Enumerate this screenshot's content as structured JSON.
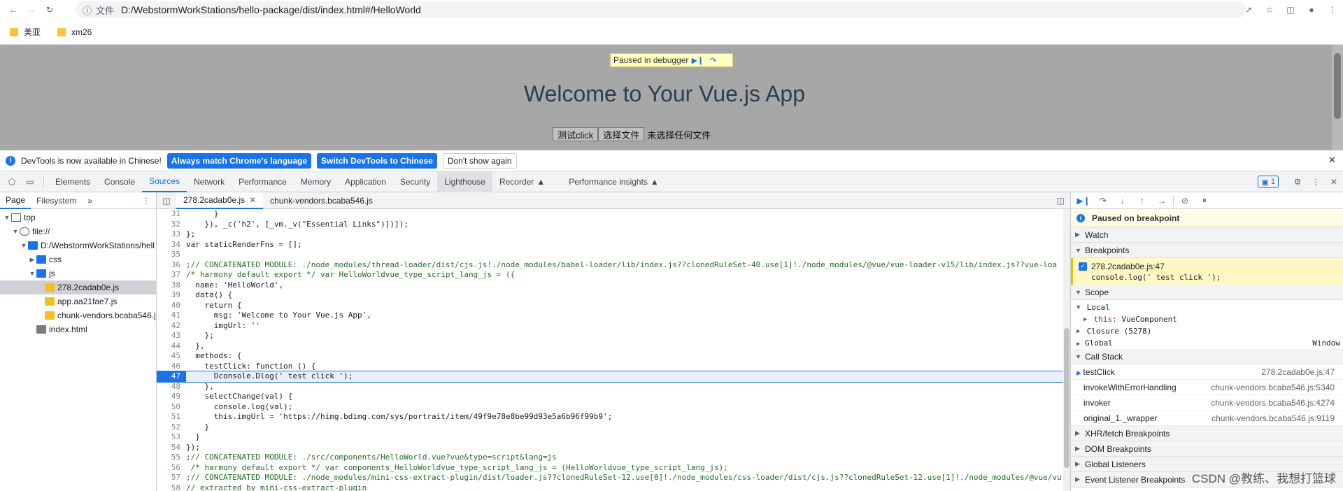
{
  "browser": {
    "file_label": "文件",
    "url": "D:/WebstormWorkStations/hello-package/dist/index.html#/HelloWorld",
    "bookmarks": [
      "美亚",
      "xm26"
    ]
  },
  "page": {
    "paused_text": "Paused in debugger",
    "title": "Welcome to Your Vue.js App",
    "test_button": "测试click",
    "file_button": "选择文件",
    "no_file": "未选择任何文件"
  },
  "infobar": {
    "message": "DevTools is now available in Chinese!",
    "btn_match": "Always match Chrome's language",
    "btn_switch": "Switch DevTools to Chinese",
    "btn_dont": "Don't show again"
  },
  "devtools": {
    "tabs": [
      "Elements",
      "Console",
      "Sources",
      "Network",
      "Performance",
      "Memory",
      "Application",
      "Security",
      "Lighthouse",
      "Recorder",
      "Performance insights"
    ],
    "issues_count": "1"
  },
  "navigator": {
    "tabs": [
      "Page",
      "Filesystem"
    ],
    "tree": [
      {
        "label": "top",
        "depth": 0,
        "icon": "frame",
        "open": true
      },
      {
        "label": "file://",
        "depth": 1,
        "icon": "cloud",
        "open": true
      },
      {
        "label": "D:/WebstormWorkStations/hell",
        "depth": 2,
        "icon": "folder",
        "open": true
      },
      {
        "label": "css",
        "depth": 3,
        "icon": "folder",
        "open": false
      },
      {
        "label": "js",
        "depth": 3,
        "icon": "folder",
        "open": true
      },
      {
        "label": "278.2cadab0e.js",
        "depth": 4,
        "icon": "file",
        "selected": true
      },
      {
        "label": "app.aa21fae7.js",
        "depth": 4,
        "icon": "file"
      },
      {
        "label": "chunk-vendors.bcaba546.j",
        "depth": 4,
        "icon": "file"
      },
      {
        "label": "index.html",
        "depth": 3,
        "icon": "html"
      }
    ]
  },
  "editor": {
    "tabs": [
      "278.2cadab0e.js",
      "chunk-vendors.bcaba546.js"
    ],
    "lines": [
      {
        "n": "31",
        "t": "      }"
      },
      {
        "n": "32",
        "t": "    }), _c('h2', [_vm._v(\"Essential Links\")])]);"
      },
      {
        "n": "33",
        "t": "};"
      },
      {
        "n": "34",
        "t": "var staticRenderFns = [];"
      },
      {
        "n": "35",
        "t": ""
      },
      {
        "n": "36",
        "t": ";// CONCATENATED MODULE: ./node_modules/thread-loader/dist/cjs.js!./node_modules/babel-loader/lib/index.js??clonedRuleSet-40.use[1]!./node_modules/@vue/vue-loader-v15/lib/index.js??vue-loa"
      },
      {
        "n": "37",
        "t": "/* harmony default export */ var HelloWorldvue_type_script_lang_js = ({"
      },
      {
        "n": "38",
        "t": "  name: 'HelloWorld',"
      },
      {
        "n": "39",
        "t": "  data() {"
      },
      {
        "n": "40",
        "t": "    return {"
      },
      {
        "n": "41",
        "t": "      msg: 'Welcome to Your Vue.js App',"
      },
      {
        "n": "42",
        "t": "      imgUrl: ''"
      },
      {
        "n": "43",
        "t": "    };"
      },
      {
        "n": "44",
        "t": "  },"
      },
      {
        "n": "45",
        "t": "  methods: {"
      },
      {
        "n": "46",
        "t": "    testClick: function () {"
      },
      {
        "n": "47",
        "t": "      Dconsole.Dlog(' test click ');",
        "exec": true
      },
      {
        "n": "48",
        "t": "    },"
      },
      {
        "n": "49",
        "t": "    selectChange(val) {"
      },
      {
        "n": "50",
        "t": "      console.log(val);"
      },
      {
        "n": "51",
        "t": "      this.imgUrl = 'https://himg.bdimg.com/sys/portrait/item/49f9e78e8be99d93e5a6b96f99b9';"
      },
      {
        "n": "52",
        "t": "    }"
      },
      {
        "n": "53",
        "t": "  }"
      },
      {
        "n": "54",
        "t": "});"
      },
      {
        "n": "55",
        "t": ";// CONCATENATED MODULE: ./src/components/HelloWorld.vue?vue&type=script&lang=js"
      },
      {
        "n": "56",
        "t": " /* harmony default export */ var components_HelloWorldvue_type_script_lang_js = (HelloWorldvue_type_script_lang_js);"
      },
      {
        "n": "57",
        "t": ";// CONCATENATED MODULE: ./node_modules/mini-css-extract-plugin/dist/loader.js??clonedRuleSet-12.use[0]!./node_modules/css-loader/dist/cjs.js??clonedRuleSet-12.use[1]!./node_modules/@vue/vu"
      },
      {
        "n": "58",
        "t": "// extracted by mini-css-extract-plugin"
      }
    ]
  },
  "debugger": {
    "paused": "Paused on breakpoint",
    "watch": "Watch",
    "breakpoints": "Breakpoints",
    "bp_file": "278.2cadab0e.js:47",
    "bp_code": "console.log(' test click ');",
    "scope": "Scope",
    "local": "Local",
    "this_key": "this:",
    "this_val": "VueComponent",
    "closure": "Closure (5278)",
    "global": "Global",
    "global_val": "Window",
    "callstack": "Call Stack",
    "frames": [
      {
        "name": "testClick",
        "loc": "278.2cadab0e.js:47"
      },
      {
        "name": "invokeWithErrorHandling",
        "loc": "chunk-vendors.bcaba546.js:5340"
      },
      {
        "name": "invoker",
        "loc": "chunk-vendors.bcaba546.js:4274"
      },
      {
        "name": "original_1._wrapper",
        "loc": "chunk-vendors.bcaba546.js:9119"
      }
    ],
    "xhr": "XHR/fetch Breakpoints",
    "dom": "DOM Breakpoints",
    "listeners": "Global Listeners",
    "event": "Event Listener Breakpoints"
  },
  "watermark": "CSDN @教练、我想打篮球"
}
